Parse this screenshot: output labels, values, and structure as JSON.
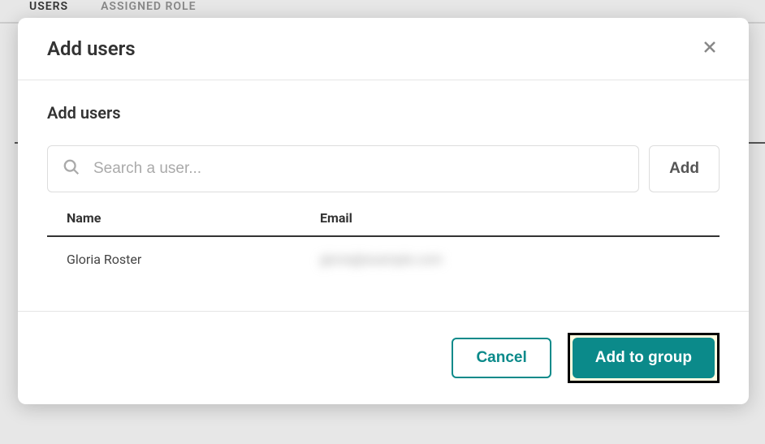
{
  "background": {
    "tabs": [
      {
        "label": "USERS",
        "active": true
      },
      {
        "label": "ASSIGNED ROLE",
        "active": false
      }
    ]
  },
  "modal": {
    "header_title": "Add users",
    "section_title": "Add users",
    "search_placeholder": "Search a user...",
    "add_button_label": "Add",
    "table": {
      "columns": {
        "name": "Name",
        "email": "Email"
      },
      "rows": [
        {
          "name": "Gloria Roster",
          "email": "gloria@example.com"
        }
      ]
    },
    "footer": {
      "cancel_label": "Cancel",
      "primary_label": "Add to group"
    }
  }
}
